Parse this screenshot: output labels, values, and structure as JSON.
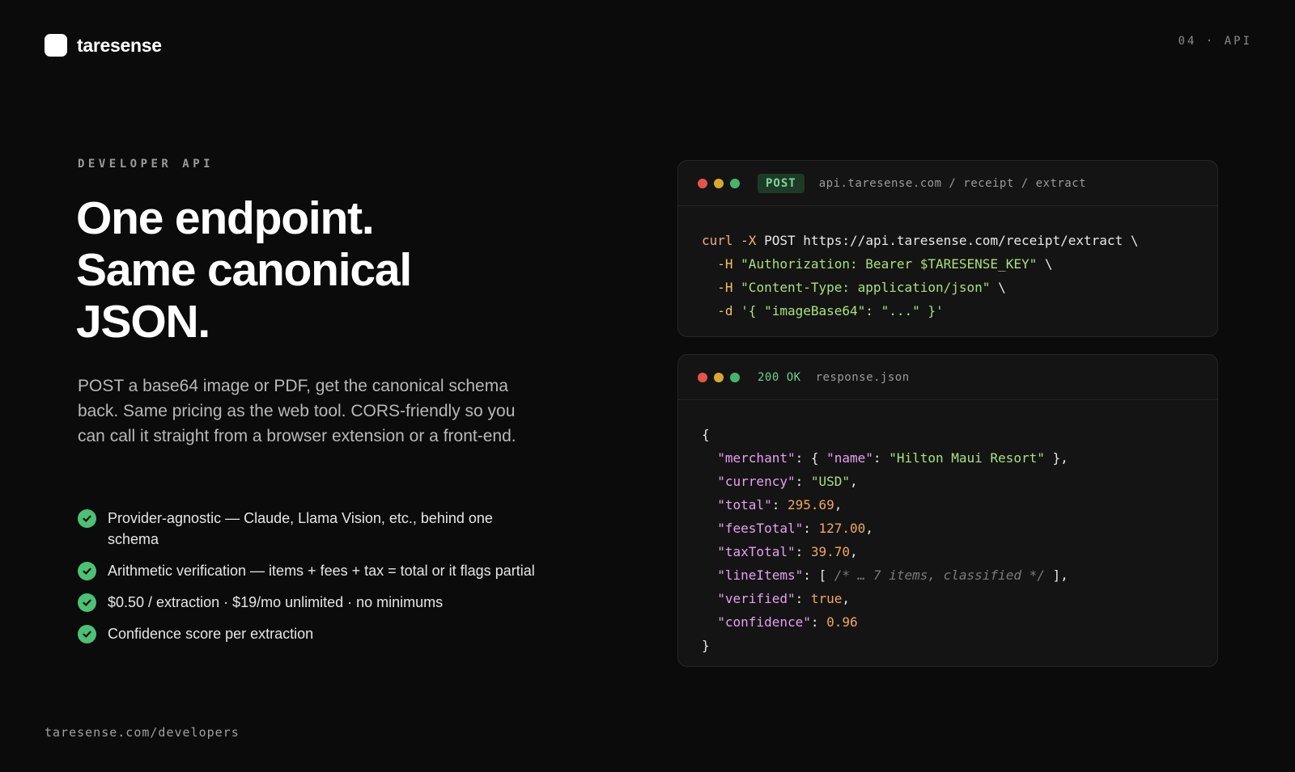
{
  "brand": {
    "name": "taresense"
  },
  "slide": {
    "label": "04 · API"
  },
  "hero": {
    "eyebrow": "DEVELOPER API",
    "headline": [
      "One endpoint.",
      "Same canonical",
      "JSON."
    ],
    "lede": "POST a base64 image or PDF, get the canonical schema back. Same pricing as the web tool. CORS-friendly so you can call it straight from a browser extension or a front-end."
  },
  "features": [
    "Provider-agnostic — Claude, Llama Vision, etc., behind one schema",
    "Arithmetic verification — items + fees + tax = total or it flags partial",
    "$0.50 / extraction · $19/mo unlimited · no minimums",
    "Confidence score per extraction"
  ],
  "footer": {
    "url": "taresense.com/developers"
  },
  "request": {
    "method": "POST",
    "path": "api.taresense.com / receipt / extract",
    "code": {
      "cmd": "curl",
      "flag_x": "-X",
      "method": "POST",
      "url": "https://api.taresense.com/receipt/extract",
      "cont": "\\",
      "h_flag": "-H",
      "auth_header": "\"Authorization: Bearer $TARESENSE_KEY\"",
      "content_header": "\"Content-Type: application/json\"",
      "d_flag": "-d",
      "body": "'{ \"imageBase64\": \"...\" }'"
    }
  },
  "response": {
    "status": "200 OK",
    "file": "response.json",
    "code": {
      "open": "{",
      "close": "}",
      "merchant_key": "\"merchant\"",
      "name_key": "\"name\"",
      "merchant_name": "\"Hilton Maui Resort\"",
      "currency_key": "\"currency\"",
      "currency": "\"USD\"",
      "total_key": "\"total\"",
      "total": "295.69",
      "fees_key": "\"feesTotal\"",
      "fees": "127.00",
      "tax_key": "\"taxTotal\"",
      "tax": "39.70",
      "items_key": "\"lineItems\"",
      "items_comment": "/* … 7 items, classified */",
      "verified_key": "\"verified\"",
      "verified": "true",
      "confidence_key": "\"confidence\"",
      "confidence": "0.96"
    }
  },
  "colors": {
    "background": "#0b0b0b",
    "check": "#4cc176",
    "window_red": "#e5534b",
    "window_yellow": "#d9a92f",
    "window_green": "#47b567"
  }
}
